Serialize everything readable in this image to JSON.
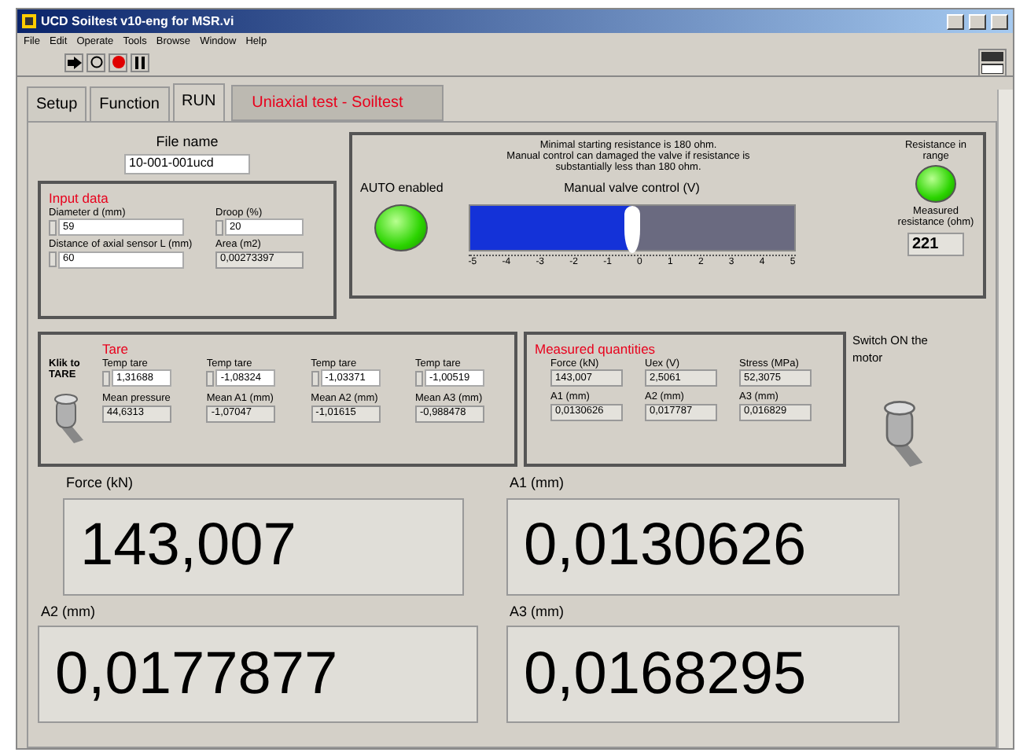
{
  "window": {
    "title": "UCD Soiltest v10-eng for MSR.vi"
  },
  "menu": [
    "File",
    "Edit",
    "Operate",
    "Tools",
    "Browse",
    "Window",
    "Help"
  ],
  "tabs": [
    {
      "label": "Setup",
      "selected": false
    },
    {
      "label": "Function",
      "selected": false
    },
    {
      "label": "RUN",
      "selected": true
    }
  ],
  "panel_title": "Uniaxial test - Soiltest",
  "file_name": {
    "label": "File name",
    "value": "10-001-001ucd"
  },
  "input_data": {
    "title": "Input data",
    "fields": [
      {
        "label": "Diameter d (mm)",
        "value": "59",
        "kind": "control"
      },
      {
        "label": "Droop (%)",
        "value": "20",
        "kind": "control"
      },
      {
        "label": "Distance of axial sensor L (mm)",
        "value": "60",
        "kind": "control"
      },
      {
        "label": "Area (m2)",
        "value": "0,00273397",
        "kind": "indicator"
      }
    ]
  },
  "valve": {
    "note": "Minimal starting resistance is 180 ohm.\nManual control can damaged the valve if resistance is\nsubstantially less than 180 ohm.",
    "auto_led": {
      "label": "AUTO enabled",
      "on": true
    },
    "slider": {
      "label": "Manual valve control (V)",
      "level": 0.5,
      "ticks": [
        "-5",
        "-4",
        "-3",
        "-2",
        "-1",
        "0",
        "1",
        "2",
        "3",
        "4",
        "5"
      ]
    },
    "range_led": {
      "label": "Resistance in range",
      "on": true
    },
    "resistance": {
      "label": "Measured resistance (ohm)",
      "value": "221"
    }
  },
  "tare": {
    "title": "Tare",
    "button_label": "Klik to TARE",
    "pressed": false,
    "temp_tares": [
      {
        "label": "Temp tare",
        "value": "1,31688"
      },
      {
        "label": "Temp tare",
        "value": "-1,08324"
      },
      {
        "label": "Temp tare",
        "value": "-1,03371"
      },
      {
        "label": "Temp tare",
        "value": "-1,00519"
      }
    ],
    "means": [
      {
        "label": "Mean pressure",
        "value": "44,6313"
      },
      {
        "label": "Mean A1 (mm)",
        "value": "-1,07047"
      },
      {
        "label": "Mean A2 (mm)",
        "value": "-1,01615"
      },
      {
        "label": "Mean A3 (mm)",
        "value": "-0,988478"
      }
    ]
  },
  "measured": {
    "title": "Measured quantities",
    "fields": [
      {
        "label": "Force (kN)",
        "value": "143,007"
      },
      {
        "label": "Uex (V)",
        "value": "2,5061"
      },
      {
        "label": "Stress (MPa)",
        "value": "52,3075"
      },
      {
        "label": "A1 (mm)",
        "value": "0,0130626"
      },
      {
        "label": "A2 (mm)",
        "value": "0,017787"
      },
      {
        "label": "A3 (mm)",
        "value": "0,016829"
      }
    ]
  },
  "motor": {
    "label": "Switch ON the motor",
    "on": false
  },
  "big_displays": [
    {
      "label": "Force (kN)",
      "value": "143,007"
    },
    {
      "label": "A1 (mm)",
      "value": "0,0130626"
    },
    {
      "label": "A2 (mm)",
      "value": "0,0177877"
    },
    {
      "label": "A3 (mm)",
      "value": "0,0168295"
    }
  ]
}
